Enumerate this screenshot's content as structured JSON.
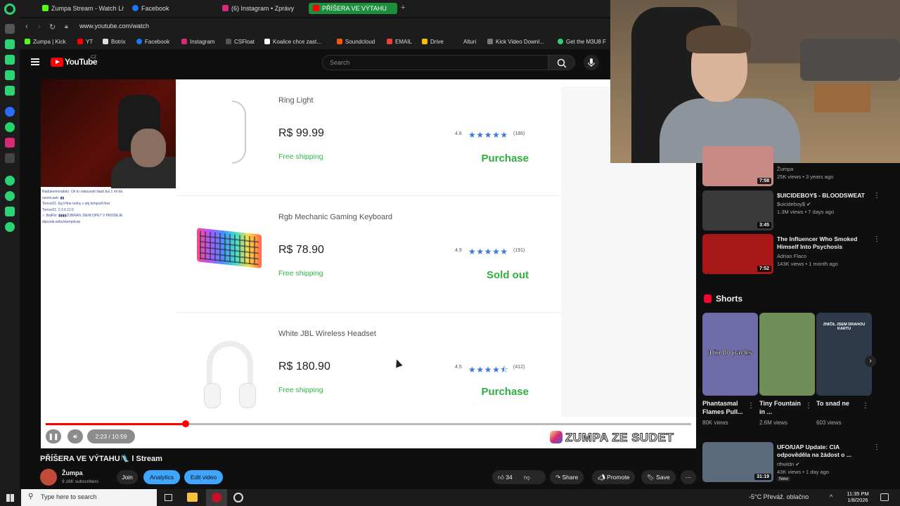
{
  "browser": {
    "tabs": [
      {
        "label": "Zumpa Stream - Watch Live",
        "color": "#53fc18"
      },
      {
        "label": "Facebook",
        "color": "#1877f2"
      },
      {
        "label": "(6) Instagram • Zprávy",
        "color": "#d62976"
      },
      {
        "label": "PŘÍŠERA VE VÝTAHU",
        "color": "#ff0000",
        "active": true
      }
    ],
    "url": "www.youtube.com/watch",
    "bookmarks": [
      "Zumpa | Kick",
      "YT",
      "Botrix",
      "Facebook",
      "Instagram",
      "CSFloat",
      "Koalice chce zast...",
      "Soundcloud",
      "EMAIL",
      "Drive",
      "Alturi",
      "Kick Video Downl...",
      "Get the M3U8 F"
    ]
  },
  "youtube": {
    "logo": "YouTube",
    "region": "CZ",
    "search_placeholder": "Search"
  },
  "chat_overlay": [
    "Radukemnradulo: Ok to vobouvaň tlaub bui 1 ml dá",
    "ozomcaok: ▮▮",
    "Tomxx01: Eg tr!tne todny v ahj bimpvdl řbot",
    "Tomxx01: 2:1:0 11:0",
    "✓ BotRix: ▮▮▮▮ZOBRAN JSEM OPET V PRODEJE",
    "dipcoda.ia/bv/dumpdcop"
  ],
  "shop": {
    "items": [
      {
        "name": "Ring Light",
        "price": "R$ 99.99",
        "shipping": "Free shipping",
        "rating": "4.8",
        "stars": "★★★★★",
        "count": "(186)",
        "action": "Purchase"
      },
      {
        "name": "Rgb Mechanic Gaming Keyboard",
        "price": "R$ 78.90",
        "shipping": "Free shipping",
        "rating": "4.9",
        "stars": "★★★★★",
        "count": "(191)",
        "action": "Sold out"
      },
      {
        "name": "White JBL Wireless Headset",
        "price": "R$ 180.90",
        "shipping": "Free shipping",
        "rating": "4.5",
        "stars": "★★★★⯪",
        "count": "(412)",
        "action": "Purchase"
      }
    ]
  },
  "player": {
    "time": "2:23 / 10:59",
    "progress": 0.217,
    "watermark": "ZUMPA ZE SUDET"
  },
  "video": {
    "title": "PŘÍŠERA VE VÝTAHU🛝 l Stream",
    "channel": "Žumpa",
    "subscribers": "9.16K subscribers",
    "join": "Join",
    "analytics": "Analytics",
    "edit": "Edit video",
    "likes": "34",
    "share": "Share",
    "promote": "Promote",
    "save": "Save"
  },
  "recommendations": [
    {
      "title": "",
      "channel": "Žumpa",
      "meta": "25K views • 3 years ago",
      "duration": "7:58",
      "thumb": "#c98a86"
    },
    {
      "title": "$UICIDEBOY$ - BLOODSWEAT",
      "channel": "$uicideboy$ ✔",
      "meta": "1.3M views • 7 days ago",
      "duration": "3:45",
      "thumb": "#3a3a3a"
    },
    {
      "title": "The Influencer Who Smoked Himself Into Psychosis",
      "channel": "Adrian Flaco",
      "meta": "143K views • 1 month ago",
      "duration": "7:52",
      "thumb": "#a81818"
    }
  ],
  "shorts": {
    "heading": "Shorts",
    "items": [
      {
        "title": "Phantasmal Flames Pull...",
        "views": "80K views",
        "overlay": "1 in 80 packs",
        "color": "#6f6aa8"
      },
      {
        "title": "Tiny Fountain in ...",
        "views": "2.6M views",
        "overlay": "",
        "color": "#6f8f5a"
      },
      {
        "title": "To snad ne",
        "views": "603 views",
        "overlay": "ZNIČIL JSEM DRAHOU KARTU",
        "color": "#2e3a4a"
      }
    ]
  },
  "rec_bottom": {
    "title": "UFO/UAP Update: CIA odpověděla na žádost o ...",
    "channel": "rthwldn ✔",
    "meta": "43K views • 1 day ago",
    "badge": "New",
    "duration": "31:19"
  },
  "taskbar": {
    "search_placeholder": "Type here to search",
    "weather": "-5°C  Převáž. oblačno",
    "time": "11:35 PM",
    "date": "1/8/2026"
  }
}
